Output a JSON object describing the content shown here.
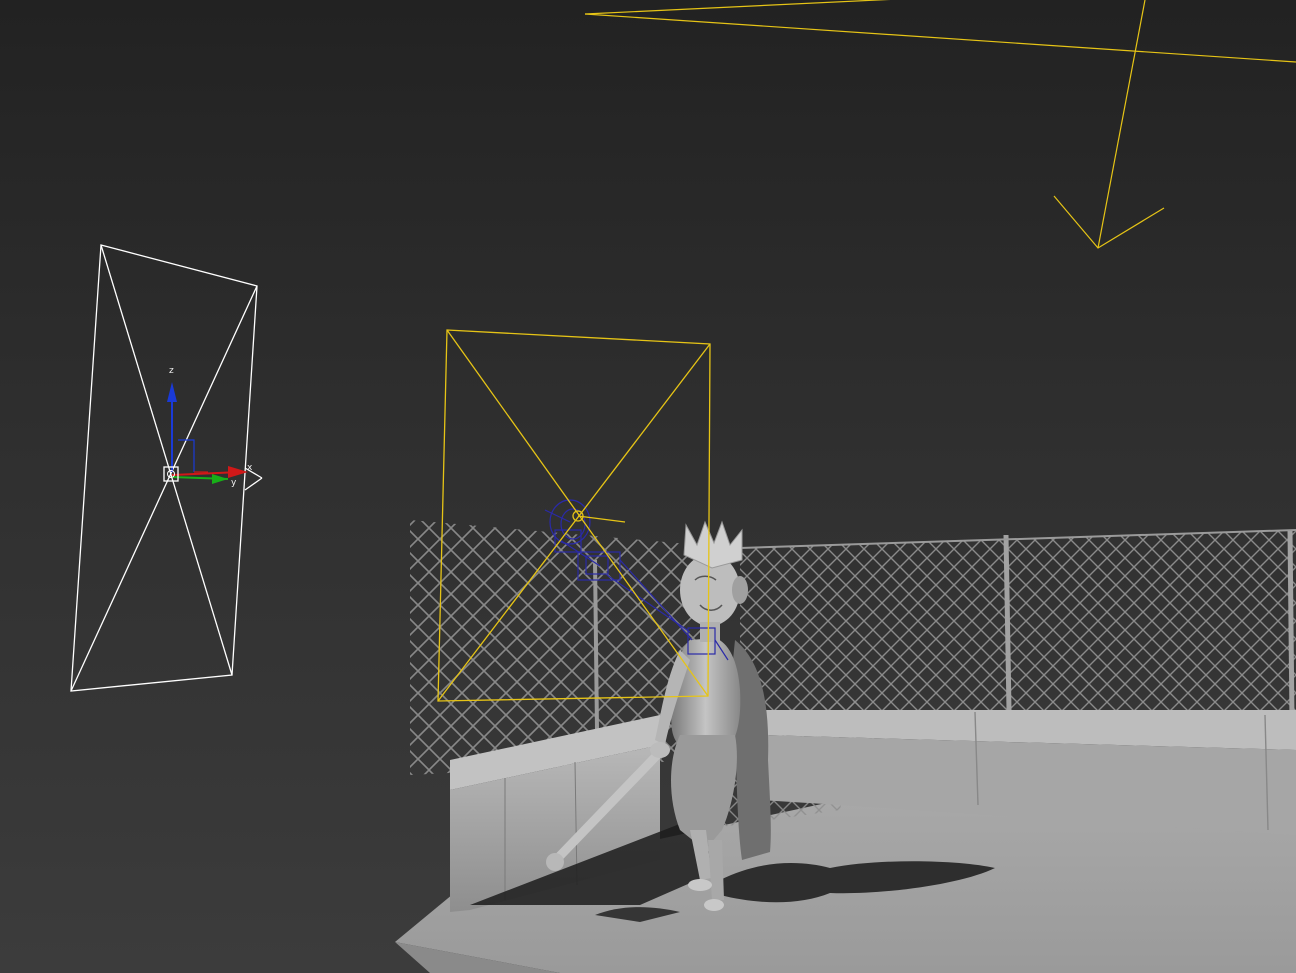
{
  "viewport": {
    "background_top": "#222222",
    "background_bottom": "#3c3c3c"
  },
  "colors": {
    "selected_light": "#e6c416",
    "unselected_light": "#ffffff",
    "bone_wireframe": "#2a2aa8",
    "axis_x": "#d01818",
    "axis_y": "#18b018",
    "axis_z": "#1a3ad8",
    "floor": "#9e9e9e",
    "fence": "#8c8c8c"
  },
  "gizmo": {
    "icon": "move-transform-gizmo-icon",
    "axes": {
      "x": "x",
      "y": "y",
      "z": "z"
    }
  },
  "scene_objects": [
    "area-light-left",
    "area-light-center",
    "directional-light",
    "chain-link-fence",
    "concrete-ledge",
    "floor-plane",
    "boy-king-character",
    "character-bone-rig"
  ]
}
